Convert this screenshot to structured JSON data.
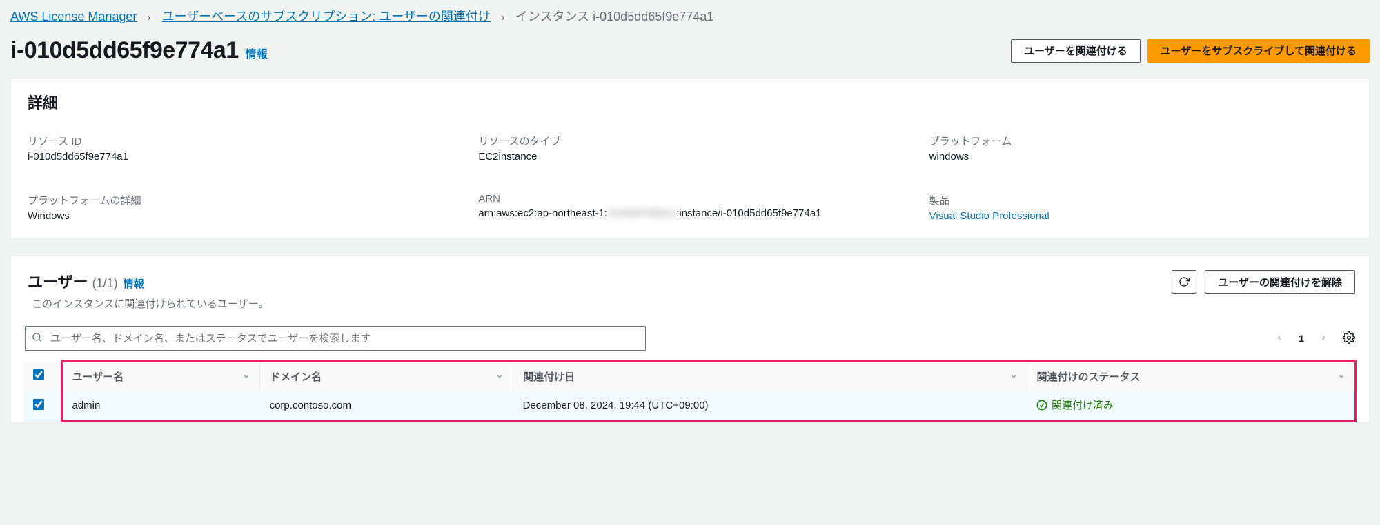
{
  "breadcrumb": {
    "item1": "AWS License Manager",
    "item2": "ユーザーベースのサブスクリプション: ユーザーの関連付け",
    "item3": "インスタンス i-010d5dd65f9e774a1"
  },
  "header": {
    "title": "i-010d5dd65f9e774a1",
    "info": "情報",
    "btn_associate": "ユーザーを関連付ける",
    "btn_subscribe_associate": "ユーザーをサブスクライブして関連付ける"
  },
  "details": {
    "title": "詳細",
    "resource_id_label": "リソース ID",
    "resource_id_value": "i-010d5dd65f9e774a1",
    "resource_type_label": "リソースのタイプ",
    "resource_type_value": "EC2instance",
    "platform_label": "プラットフォーム",
    "platform_value": "windows",
    "platform_detail_label": "プラットフォームの詳細",
    "platform_detail_value": "Windows",
    "arn_label": "ARN",
    "arn_value_pre": "arn:aws:ec2:ap-northeast-1:",
    "arn_value_post": ":instance/i-010d5dd65f9e774a1",
    "product_label": "製品",
    "product_value": "Visual Studio Professional"
  },
  "users": {
    "title": "ユーザー",
    "count": "(1/1)",
    "info": "情報",
    "desc": "このインスタンスに関連付けられているユーザー。",
    "btn_disassociate": "ユーザーの関連付けを解除",
    "search_placeholder": "ユーザー名、ドメイン名、またはステータスでユーザーを検索します",
    "page": "1",
    "columns": {
      "username": "ユーザー名",
      "domain": "ドメイン名",
      "assoc_date": "関連付け日",
      "assoc_status": "関連付けのステータス"
    },
    "rows": [
      {
        "username": "admin",
        "domain": "corp.contoso.com",
        "date": "December 08, 2024, 19:44 (UTC+09:00)",
        "status": "関連付け済み"
      }
    ]
  }
}
